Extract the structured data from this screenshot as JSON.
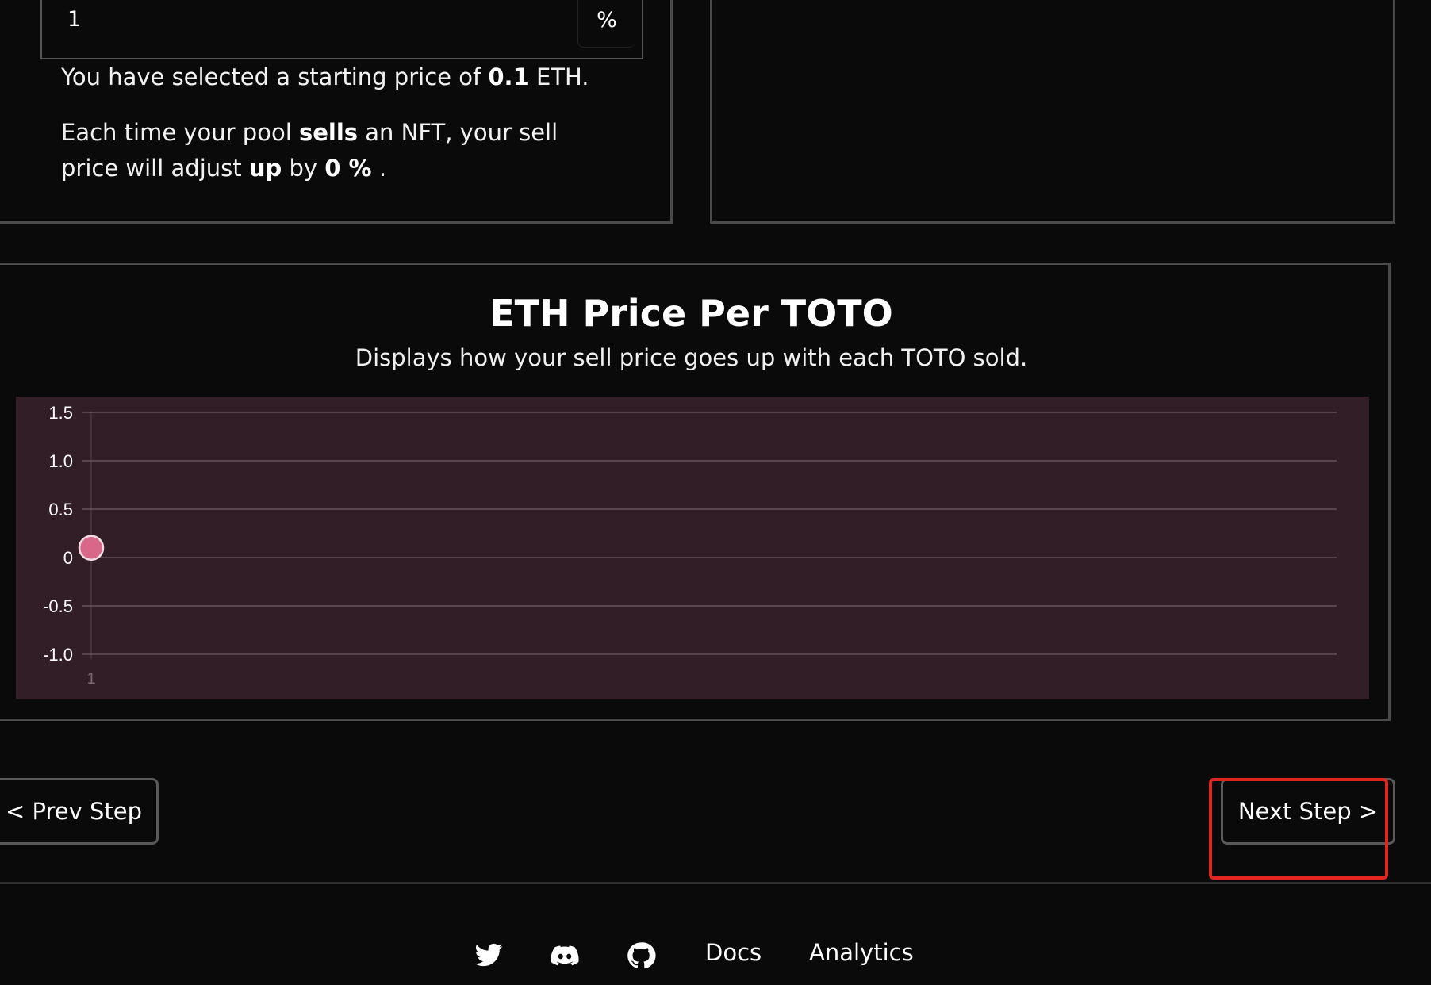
{
  "percent_input": {
    "value": "1",
    "unit": "%"
  },
  "summary": {
    "line1_prefix": "You have selected a starting price of",
    "start_price": "0.1",
    "line1_suffix": "ETH.",
    "line2_a": "Each time your pool",
    "line2_sells": "sells",
    "line2_b": "an NFT, your sell price",
    "line2_c": "will adjust",
    "line2_up": "up",
    "line2_by": "by",
    "line2_delta": "0 %",
    "line2_end": "."
  },
  "chart": {
    "title": "ETH Price Per TOTO",
    "subtitle": "Displays how your sell price goes up with each TOTO sold."
  },
  "chart_data": {
    "type": "scatter",
    "title": "ETH Price Per TOTO",
    "subtitle": "Displays how your sell price goes up with each TOTO sold.",
    "x": [
      1
    ],
    "y": [
      0.1
    ],
    "categories": [
      "1"
    ],
    "ylim": [
      -1.0,
      1.5
    ],
    "yticks": [
      "1.5",
      "1.0",
      "0.5",
      "0",
      "-0.5",
      "-1.0"
    ],
    "ytick_values": [
      1.5,
      1.0,
      0.5,
      0,
      -0.5,
      -1.0
    ],
    "grid": true,
    "point_color": "#d9678a",
    "background": "#321e26"
  },
  "nav": {
    "prev_label": "< Prev Step",
    "next_label": "Next Step >"
  },
  "footer": {
    "docs": "Docs",
    "analytics": "Analytics"
  },
  "colors": {
    "highlight": "#e0261e",
    "chart_bg": "#321e26",
    "point": "#d9678a"
  }
}
